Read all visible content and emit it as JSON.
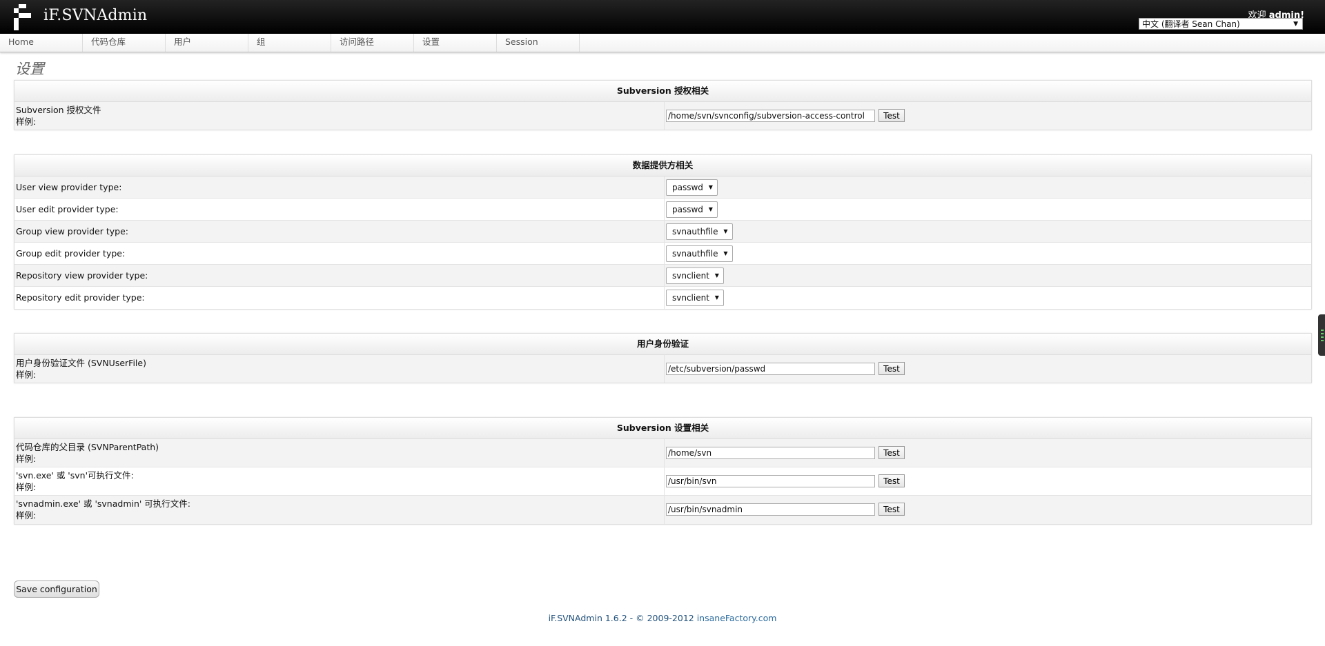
{
  "header": {
    "brand": "iF.SVNAdmin",
    "welcome_prefix": "欢迎",
    "user": "admin!",
    "language": "中文 (翻译者 Sean Chan)"
  },
  "nav": [
    "Home",
    "代码仓库",
    "用户",
    "组",
    "访问路径",
    "设置",
    "Session"
  ],
  "page_title": "设置",
  "sections": {
    "auth": {
      "title": "Subversion 授权相关",
      "rows": [
        {
          "label": "Subversion 授权文件",
          "example": "样例:",
          "value": "/home/svn/svnconfig/subversion-access-control",
          "button": "Test"
        }
      ]
    },
    "providers": {
      "title": "数据提供方相关",
      "rows": [
        {
          "label": "User view provider type:",
          "value": "passwd"
        },
        {
          "label": "User edit provider type:",
          "value": "passwd"
        },
        {
          "label": "Group view provider type:",
          "value": "svnauthfile"
        },
        {
          "label": "Group edit provider type:",
          "value": "svnauthfile"
        },
        {
          "label": "Repository view provider type:",
          "value": "svnclient"
        },
        {
          "label": "Repository edit provider type:",
          "value": "svnclient"
        }
      ]
    },
    "userauth": {
      "title": "用户身份验证",
      "rows": [
        {
          "label": "用户身份验证文件 (SVNUserFile)",
          "example": "样例:",
          "value": "/etc/subversion/passwd",
          "button": "Test"
        }
      ]
    },
    "svn": {
      "title": "Subversion 设置相关",
      "rows": [
        {
          "label": "代码仓库的父目录 (SVNParentPath)",
          "example": "样例:",
          "value": "/home/svn",
          "button": "Test"
        },
        {
          "label": "'svn.exe' 或 'svn'可执行文件:",
          "example": "样例:",
          "value": "/usr/bin/svn",
          "button": "Test"
        },
        {
          "label": "'svnadmin.exe' 或 'svnadmin' 可执行文件:",
          "example": "样例:",
          "value": "/usr/bin/svnadmin",
          "button": "Test"
        }
      ]
    }
  },
  "save_button": "Save configuration",
  "footer": {
    "product": "iF.SVNAdmin 1.6.2",
    "copyright": " - © 2009-2012 ",
    "link": "insaneFactory.com"
  }
}
